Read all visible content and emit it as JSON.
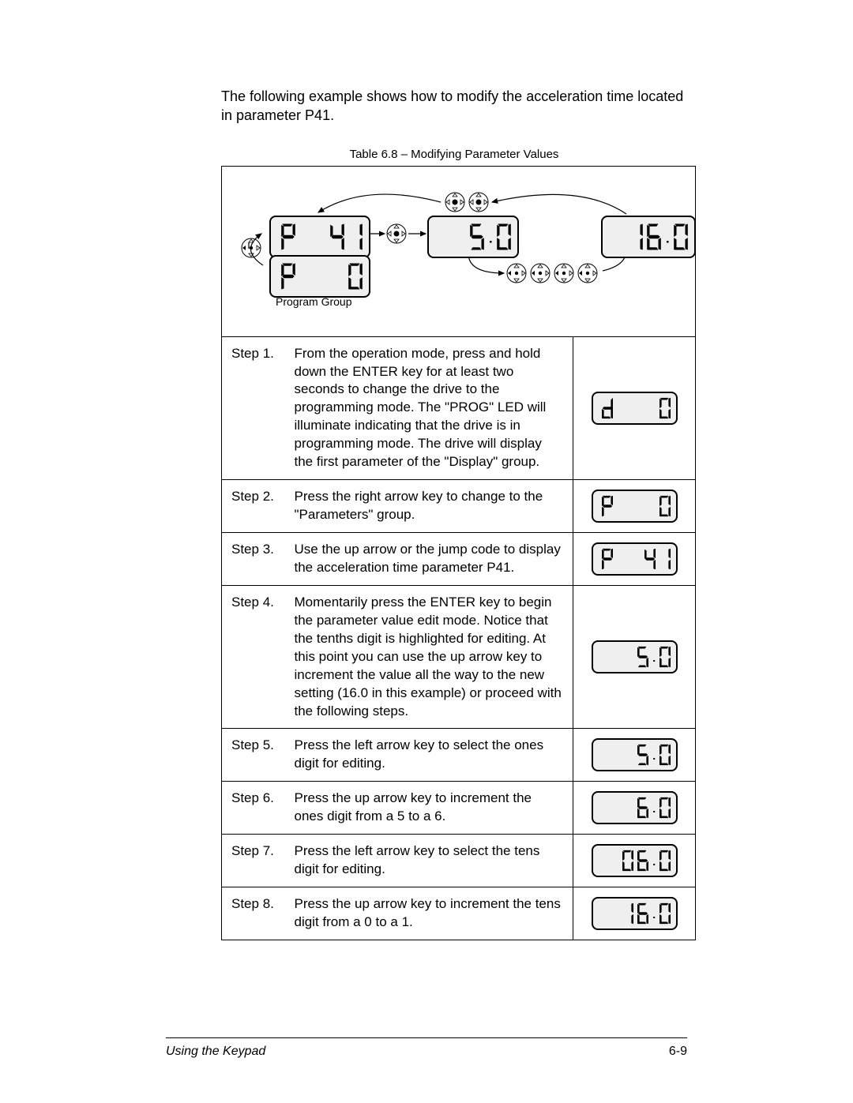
{
  "intro": "The following example shows how to modify the acceleration time located in parameter P41.",
  "table_caption": "Table 6.8 – Modifying Parameter Values",
  "diagram": {
    "lcd_p41": "P 41",
    "lcd_p0": "P  0",
    "lcd_5_0": "5.0",
    "lcd_16_0": "16.0",
    "program_group_label": "Program Group"
  },
  "steps": [
    {
      "label": "Step 1.",
      "text": "From the operation mode, press and hold down the ENTER key for at least two seconds to change the drive to the programming mode. The \"PROG\" LED will illuminate indicating that the drive is in programming mode. The drive will display the first parameter of the \"Display\" group.",
      "display": "d  0"
    },
    {
      "label": "Step 2.",
      "text": "Press the right arrow key to change to the \"Parameters\" group.",
      "display": "P  0"
    },
    {
      "label": "Step 3.",
      "text": "Use the up arrow or the jump code to display the acceleration time parameter P41.",
      "display": "P 41"
    },
    {
      "label": "Step 4.",
      "text": "Momentarily press the ENTER key to begin the parameter value edit mode. Notice that the tenths digit is highlighted for editing. At this point you can use the up arrow key to increment the value all the way to the new setting (16.0 in this example) or proceed with the following steps.",
      "display": "5.0"
    },
    {
      "label": "Step 5.",
      "text": "Press the left arrow key to select the ones digit for editing.",
      "display": "5.0"
    },
    {
      "label": "Step 6.",
      "text": "Press the up arrow key to increment the ones digit from a 5 to a 6.",
      "display": "6.0"
    },
    {
      "label": "Step 7.",
      "text": "Press the left arrow key to select the tens digit for editing.",
      "display": "06.0"
    },
    {
      "label": "Step 8.",
      "text": "Press the up arrow key to increment the tens digit from a 0 to a 1.",
      "display": "16.0"
    }
  ],
  "footer": {
    "section": "Using the Keypad",
    "page": "6-9"
  }
}
